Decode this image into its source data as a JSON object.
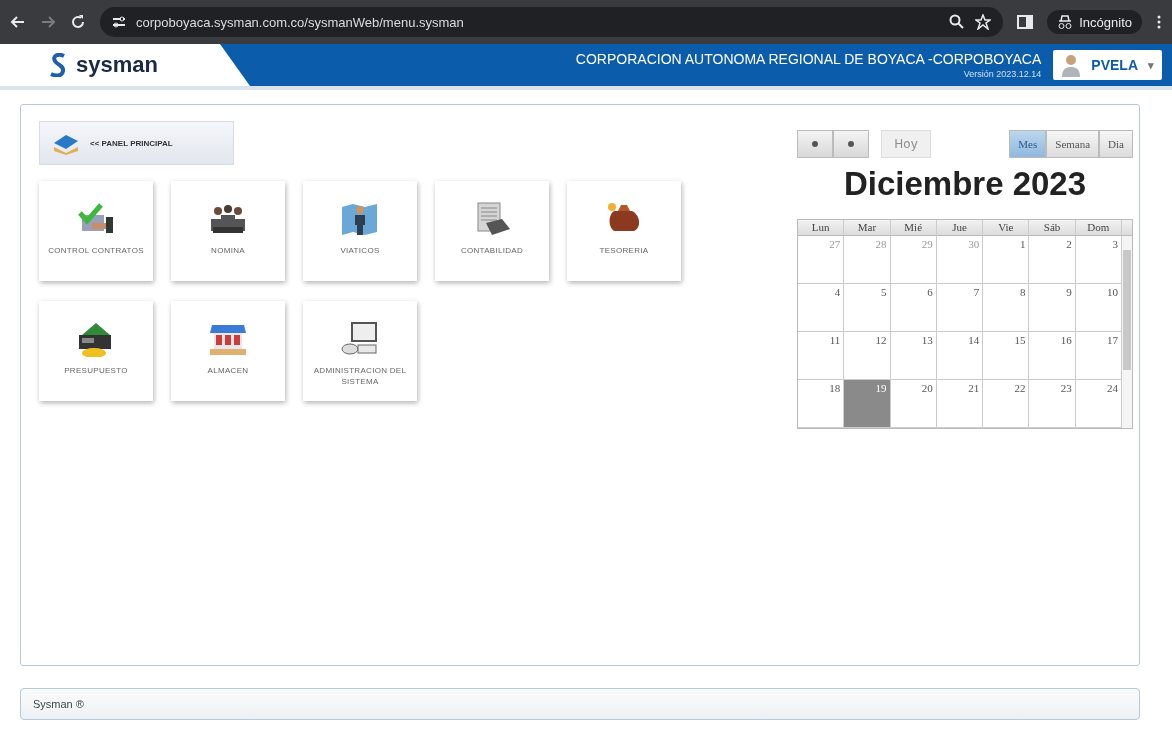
{
  "browser": {
    "url": "corpoboyaca.sysman.com.co/sysmanWeb/menu.sysman",
    "profile": "Incógnito",
    "forward_disabled": true
  },
  "header": {
    "logo": "sysman",
    "organization": "CORPORACION AUTONOMA REGIONAL DE BOYACA -CORPOBOYACA",
    "version": "Versión 2023.12.14",
    "user": "PVELA",
    "user_caret": "▾"
  },
  "panel_button": "<< PANEL PRINCIPAL",
  "modules": [
    {
      "label": "CONTROL CONTRATOS"
    },
    {
      "label": "NOMINA"
    },
    {
      "label": "VIATICOS"
    },
    {
      "label": "CONTABILIDAD"
    },
    {
      "label": "TESORERIA"
    },
    {
      "label": "PRESUPUESTO"
    },
    {
      "label": "ALMACEN"
    },
    {
      "label": "ADMINISTRACION DEL SISTEMA"
    }
  ],
  "calendar": {
    "today_button": {
      "label": "Hoy",
      "disabled": true
    },
    "views": [
      {
        "label": "Mes",
        "selected": true
      },
      {
        "label": "Semana",
        "selected": false
      },
      {
        "label": "Dia",
        "selected": false
      }
    ],
    "title": "Diciembre 2023",
    "weekdays": [
      "Lun",
      "Mar",
      "Mié",
      "Jue",
      "Vie",
      "Sáb",
      "Dom"
    ],
    "weeks": [
      [
        {
          "day": "27",
          "other_month": true,
          "selected": false
        },
        {
          "day": "28",
          "other_month": true,
          "selected": false
        },
        {
          "day": "29",
          "other_month": true,
          "selected": false
        },
        {
          "day": "30",
          "other_month": true,
          "selected": false
        },
        {
          "day": "1",
          "other_month": false,
          "selected": false
        },
        {
          "day": "2",
          "other_month": false,
          "selected": false
        },
        {
          "day": "3",
          "other_month": false,
          "selected": false
        }
      ],
      [
        {
          "day": "4",
          "other_month": false,
          "selected": false
        },
        {
          "day": "5",
          "other_month": false,
          "selected": false
        },
        {
          "day": "6",
          "other_month": false,
          "selected": false
        },
        {
          "day": "7",
          "other_month": false,
          "selected": false
        },
        {
          "day": "8",
          "other_month": false,
          "selected": false
        },
        {
          "day": "9",
          "other_month": false,
          "selected": false
        },
        {
          "day": "10",
          "other_month": false,
          "selected": false
        }
      ],
      [
        {
          "day": "11",
          "other_month": false,
          "selected": false
        },
        {
          "day": "12",
          "other_month": false,
          "selected": false
        },
        {
          "day": "13",
          "other_month": false,
          "selected": false
        },
        {
          "day": "14",
          "other_month": false,
          "selected": false
        },
        {
          "day": "15",
          "other_month": false,
          "selected": false
        },
        {
          "day": "16",
          "other_month": false,
          "selected": false
        },
        {
          "day": "17",
          "other_month": false,
          "selected": false
        }
      ],
      [
        {
          "day": "18",
          "other_month": false,
          "selected": false
        },
        {
          "day": "19",
          "other_month": false,
          "selected": true
        },
        {
          "day": "20",
          "other_month": false,
          "selected": false
        },
        {
          "day": "21",
          "other_month": false,
          "selected": false
        },
        {
          "day": "22",
          "other_month": false,
          "selected": false
        },
        {
          "day": "23",
          "other_month": false,
          "selected": false
        },
        {
          "day": "24",
          "other_month": false,
          "selected": false
        }
      ]
    ]
  },
  "footer": "Sysman ®"
}
